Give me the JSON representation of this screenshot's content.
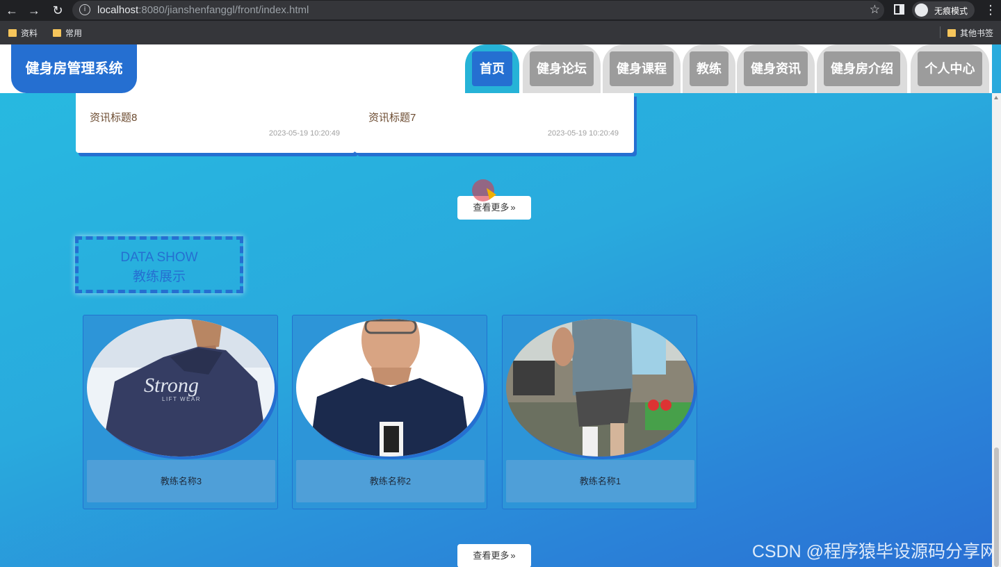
{
  "browser": {
    "url_host": "localhost",
    "url_rest": ":8080/jianshenfanggl/front/index.html",
    "incognito_label": "无痕模式",
    "bookmarks": [
      "资料",
      "常用"
    ],
    "other_bookmarks": "其他书签"
  },
  "site": {
    "logo": "健身房管理系统",
    "nav": [
      "首页",
      "健身论坛",
      "健身课程",
      "教练",
      "健身资讯",
      "健身房介绍",
      "个人中心"
    ],
    "active_nav": "首页"
  },
  "news": [
    {
      "title": "资讯标题8",
      "time": "2023-05-19 10:20:49"
    },
    {
      "title": "资讯标题7",
      "time": "2023-05-19 10:20:49"
    }
  ],
  "more_label": "查看更多",
  "section": {
    "en": "DATA SHOW",
    "zh": "教练展示"
  },
  "coaches": [
    {
      "name": "教练名称3",
      "shirt_text": "Strong",
      "shirt_subtext": "LIFT WEAR"
    },
    {
      "name": "教练名称2"
    },
    {
      "name": "教练名称1"
    }
  ],
  "watermark": "CSDN @程序猿毕设源码分享网",
  "colors": {
    "primary": "#256fd1",
    "accent": "#26b3d7",
    "tab_gray": "#9c9c9c"
  }
}
